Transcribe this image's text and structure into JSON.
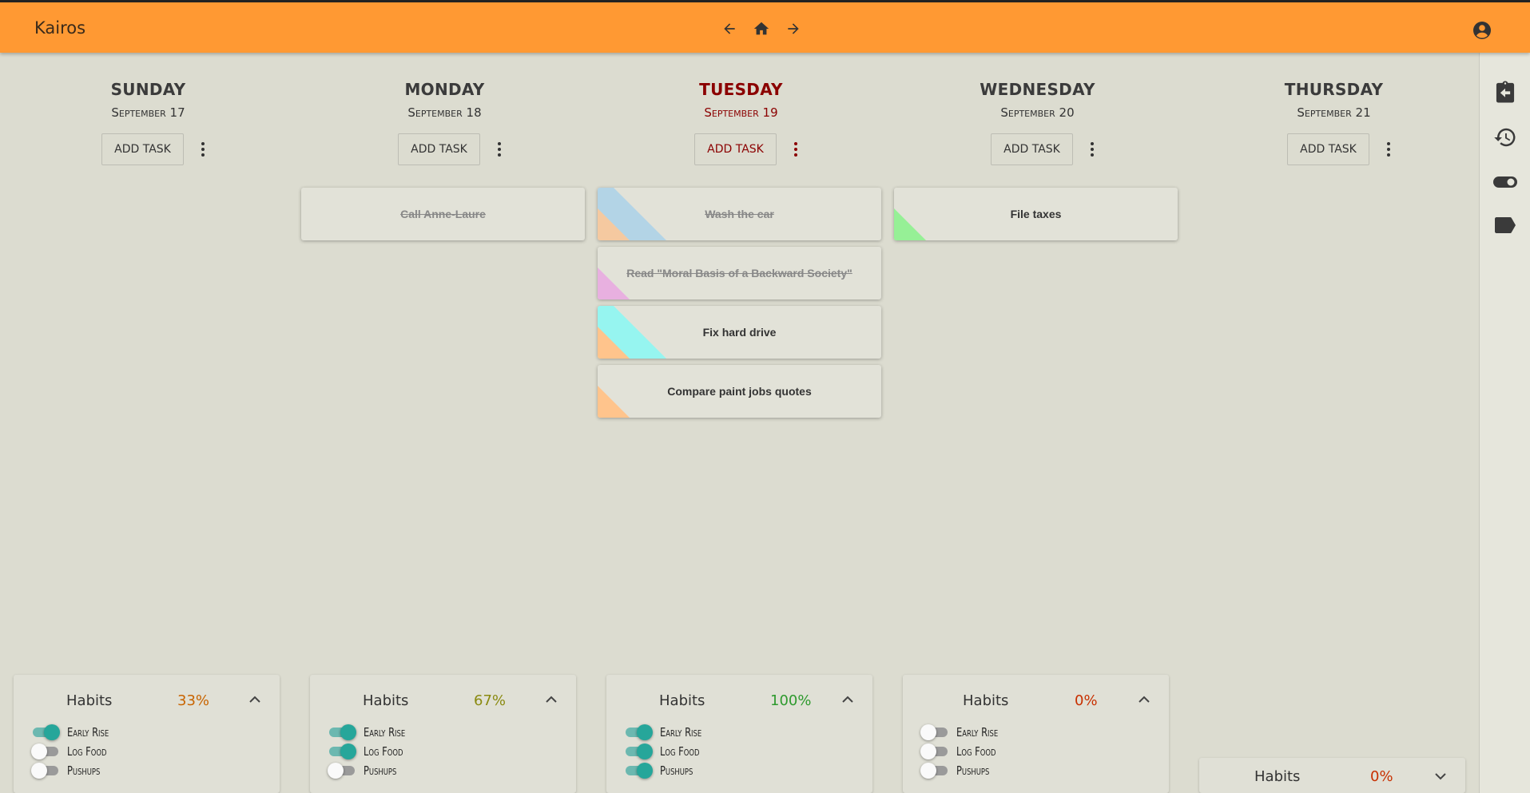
{
  "app": {
    "title": "Kairos"
  },
  "days": [
    {
      "name": "SUNDAY",
      "date": "September 17",
      "add_label": "ADD TASK"
    },
    {
      "name": "MONDAY",
      "date": "September 18",
      "add_label": "ADD TASK"
    },
    {
      "name": "TUESDAY",
      "date": "September 19",
      "add_label": "ADD TASK"
    },
    {
      "name": "WEDNESDAY",
      "date": "September 20",
      "add_label": "ADD TASK"
    },
    {
      "name": "THURSDAY",
      "date": "September 21",
      "add_label": "ADD TASK"
    }
  ],
  "tasks": {
    "monday": [
      {
        "text": "Call Anne-Laure",
        "done": true
      }
    ],
    "tuesday": [
      {
        "text": "Wash the car",
        "done": true,
        "colors": [
          "#f5c9a0",
          "#b3d4e6"
        ]
      },
      {
        "text": "Read \"Moral Basis of a Backward Society\"",
        "done": true,
        "colors": [
          "#e8b0e0"
        ]
      },
      {
        "text": "Fix hard drive",
        "done": false,
        "colors": [
          "#ffc48c",
          "#96f5f0"
        ]
      },
      {
        "text": "Compare paint jobs quotes",
        "done": false,
        "colors": [
          "#ffc48c"
        ]
      }
    ],
    "wednesday": [
      {
        "text": "File taxes",
        "done": false,
        "colors": [
          "#96f096"
        ]
      }
    ]
  },
  "habits": [
    {
      "title": "Habits",
      "percent": "33%",
      "color": "#c86400",
      "items": [
        {
          "label": "Early Rise",
          "on": true
        },
        {
          "label": "Log Food",
          "on": false
        },
        {
          "label": "Pushups",
          "on": false
        }
      ]
    },
    {
      "title": "Habits",
      "percent": "67%",
      "color": "#8a8a10",
      "items": [
        {
          "label": "Early Rise",
          "on": true
        },
        {
          "label": "Log Food",
          "on": true
        },
        {
          "label": "Pushups",
          "on": false
        }
      ]
    },
    {
      "title": "Habits",
      "percent": "100%",
      "color": "#2e9a2e",
      "items": [
        {
          "label": "Early Rise",
          "on": true
        },
        {
          "label": "Log Food",
          "on": true
        },
        {
          "label": "Pushups",
          "on": true
        }
      ]
    },
    {
      "title": "Habits",
      "percent": "0%",
      "color": "#c83000",
      "items": [
        {
          "label": "Early Rise",
          "on": false
        },
        {
          "label": "Log Food",
          "on": false
        },
        {
          "label": "Pushups",
          "on": false
        }
      ]
    },
    {
      "title": "Habits",
      "percent": "0%",
      "color": "#c83000",
      "items": []
    }
  ],
  "icons": {
    "nav": [
      "arrow-left-icon",
      "home-icon",
      "arrow-right-icon"
    ],
    "account": "account-circle-icon",
    "sidebar": [
      "clipboard-arrow-left-icon",
      "history-icon",
      "toggle-switch-icon",
      "label-icon"
    ]
  },
  "colors": {
    "topbar": "#ff9933",
    "background": "#dcdcd0",
    "today": "#8b0000",
    "toggle_on": "#26a69a"
  }
}
